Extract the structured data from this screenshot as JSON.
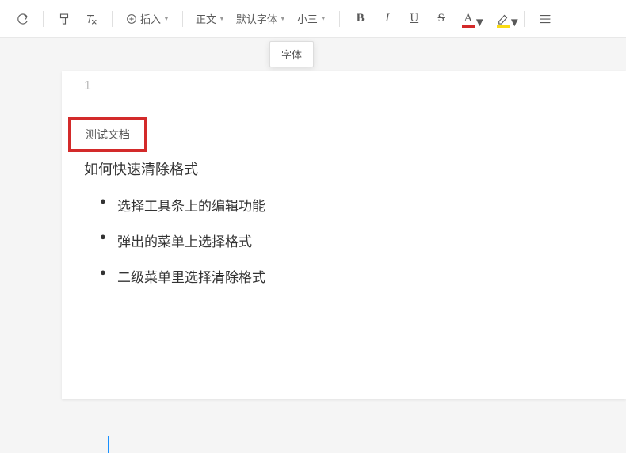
{
  "toolbar": {
    "insert_label": "插入",
    "style_label": "正文",
    "font_label": "默认字体",
    "size_label": "小三",
    "bold": "B",
    "italic": "I",
    "underline": "U",
    "strike": "S",
    "font_color_letter": "A"
  },
  "tooltip": "字体",
  "doc": {
    "page_number": "1",
    "tab_label": "测试文档",
    "heading": "如何快速清除格式",
    "bullets": [
      "选择工具条上的编辑功能",
      "弹出的菜单上选择格式",
      "二级菜单里选择清除格式"
    ]
  },
  "colors": {
    "highlight_box": "#d32a2a",
    "font_color_bar": "#d32a2a",
    "highlight_bar": "#fadb14"
  }
}
